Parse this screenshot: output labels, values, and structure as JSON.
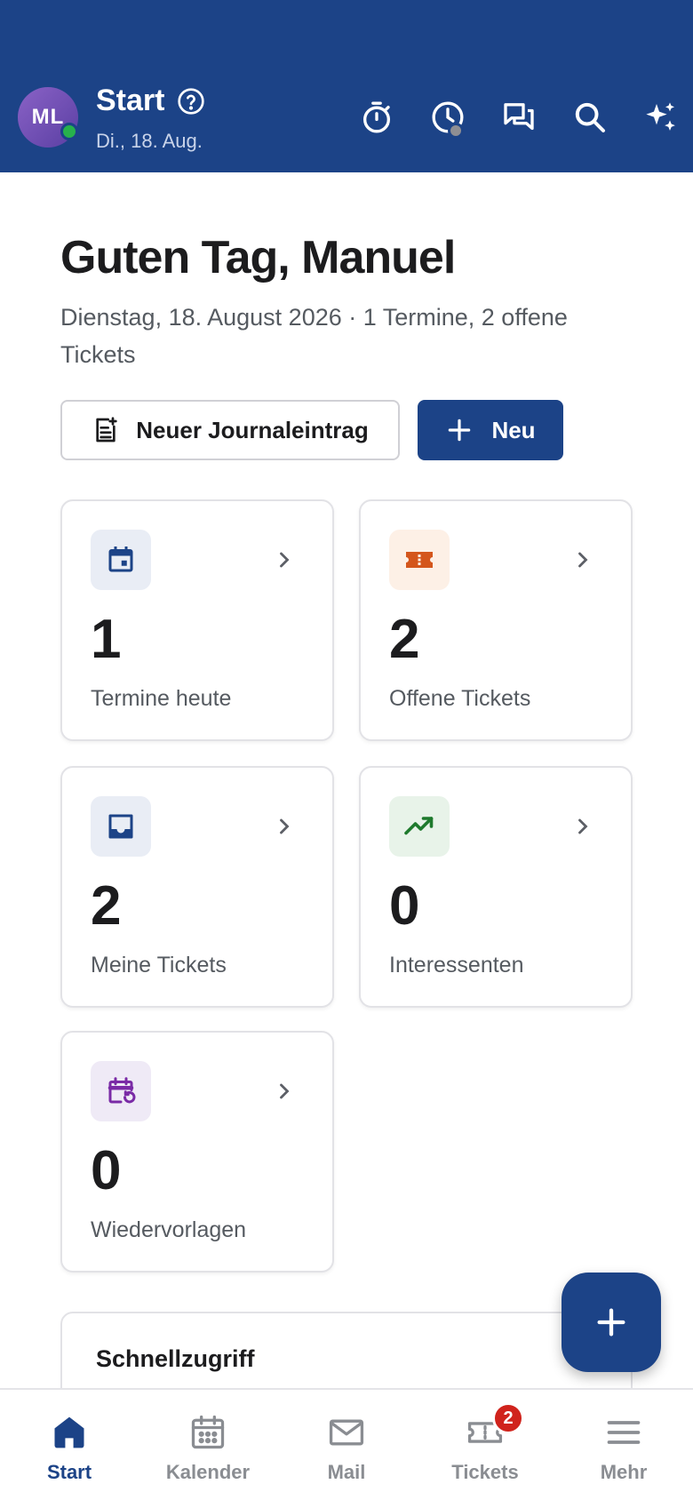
{
  "header": {
    "avatar_initials": "ML",
    "title": "Start",
    "date": "Di., 18. Aug.",
    "colors": {
      "background": "#1c4387",
      "presence": "#27b14c"
    },
    "actions": [
      {
        "name": "timer-button",
        "icon": "stopwatch-icon"
      },
      {
        "name": "time-tracking-button",
        "icon": "clock-icon"
      },
      {
        "name": "chat-button",
        "icon": "chat-icon"
      },
      {
        "name": "search-button",
        "icon": "search-icon"
      },
      {
        "name": "ai-assistant-button",
        "icon": "sparkles-icon"
      }
    ]
  },
  "main": {
    "greeting": "Guten Tag, Manuel",
    "subline": "Dienstag, 18. August 2026 · 1 Termine, 2 offene Tickets",
    "buttons": {
      "journal_label": "Neuer Journaleintrag",
      "new_label": "Neu"
    },
    "cards": [
      {
        "count": "1",
        "label": "Termine heute",
        "icon": "calendar-icon",
        "tint": "#e9edf5",
        "icon_color": "#1c4387"
      },
      {
        "count": "2",
        "label": "Offene Tickets",
        "icon": "ticket-icon",
        "tint": "#fdf0e6",
        "icon_color": "#d4561c"
      },
      {
        "count": "2",
        "label": "Meine Tickets",
        "icon": "inbox-icon",
        "tint": "#e9edf5",
        "icon_color": "#1c4387"
      },
      {
        "count": "0",
        "label": "Interessenten",
        "icon": "trending-up-icon",
        "tint": "#e8f3e9",
        "icon_color": "#1e7a2d"
      },
      {
        "count": "0",
        "label": "Wiedervorlagen",
        "icon": "calendar-repeat-icon",
        "tint": "#efeaf6",
        "icon_color": "#7a2aa6"
      }
    ],
    "quick_access_title": "Schnellzugriff"
  },
  "bottom_nav": {
    "items": [
      {
        "label": "Start",
        "icon": "home-icon",
        "active": true
      },
      {
        "label": "Kalender",
        "icon": "calendar-icon",
        "active": false
      },
      {
        "label": "Mail",
        "icon": "mail-icon",
        "active": false
      },
      {
        "label": "Tickets",
        "icon": "ticket-icon",
        "active": false,
        "badge": "2"
      },
      {
        "label": "Mehr",
        "icon": "menu-icon",
        "active": false
      }
    ],
    "colors": {
      "active": "#1c4387",
      "inactive": "#8a8d92",
      "badge": "#d0231c"
    }
  }
}
